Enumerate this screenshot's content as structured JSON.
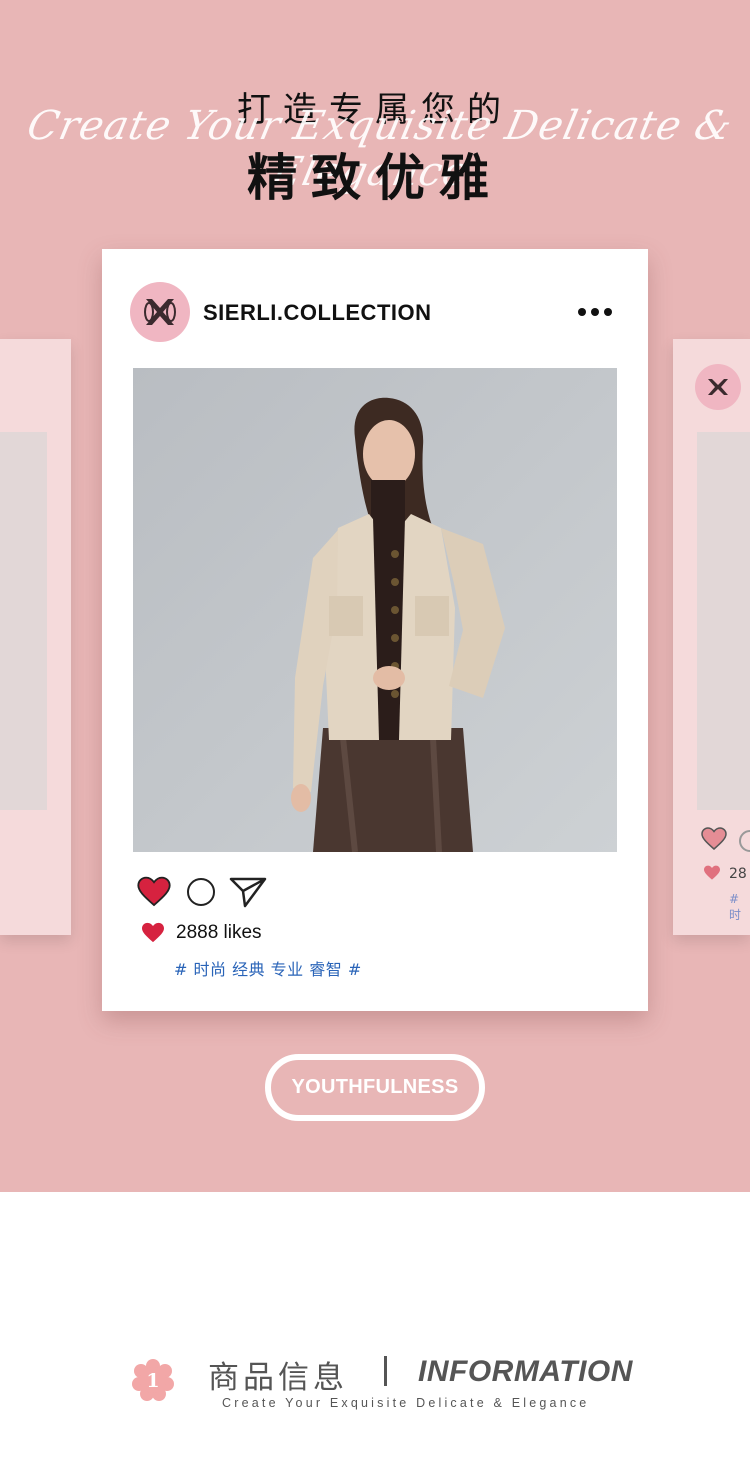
{
  "hero": {
    "title_top": "打造专属您的",
    "title_script": "Create Your Exquisite Delicate & Elegance",
    "title_big": "精致优雅",
    "background_color": "#e8b6b6"
  },
  "post": {
    "account_name": "SIERLI.COLLECTION",
    "logo_icon": "sierli-monogram-logo",
    "more_icon": "more-dots-icon",
    "photo_description_icon": "product-photo",
    "like_icon": "heart-icon",
    "comment_icon": "comment-circle-icon",
    "share_icon": "send-icon",
    "likes_text": "2888 likes",
    "tags": "# 时尚 经典 专业 睿智 #",
    "heart_color": "#d6223f",
    "tag_color": "#2a64b8"
  },
  "side_cards": {
    "right_likes_fragment": "28",
    "right_tags_fragment": "# 时"
  },
  "badge": {
    "label": "YOUTHFULNESS"
  },
  "info": {
    "number": "1",
    "title_cn": "商品信息",
    "title_en": "INFORMATION",
    "subtitle": "Create Your Exquisite Delicate & Elegance"
  }
}
